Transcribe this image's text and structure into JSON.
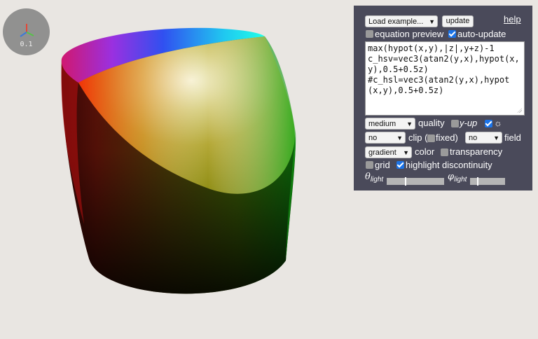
{
  "axes": {
    "scale_label": "0.1",
    "x_color": "#2f6fd8",
    "y_color": "#4bbf3a",
    "z_color": "#e23a2a"
  },
  "toolbar": {
    "example_select": "Load example...",
    "update_label": "update",
    "help_label": "help"
  },
  "options": {
    "equation_preview": {
      "label": "equation preview",
      "checked": false
    },
    "auto_update": {
      "label": "auto-update",
      "checked": true
    }
  },
  "editor": {
    "text": "max(hypot(x,y),|z|,y+z)-1\nc_hsv=vec3(atan2(y,x),hypot(x,y),0.5+0.5z)\n#c_hsl=vec3(atan2(y,x),hypot(x,y),0.5+0.5z)"
  },
  "controls": {
    "quality_select": "medium",
    "quality_label": "quality",
    "y_up": {
      "label": "y-up",
      "checked": false
    },
    "light_toggle": {
      "label": "☼",
      "checked": true
    },
    "clip_select": "no",
    "clip_label": "clip (",
    "fixed": {
      "label": "fixed)",
      "checked": false
    },
    "field_select": "no",
    "field_label": "field",
    "color_select": "gradient",
    "color_label": "color",
    "transparency": {
      "label": "transparency",
      "checked": false
    },
    "grid": {
      "label": "grid",
      "checked": false
    },
    "highlight_discontinuity": {
      "label": "highlight discontinuity",
      "checked": true
    },
    "theta_light": {
      "symbol": "θ",
      "sub": "light",
      "level": 0.32
    },
    "phi_light": {
      "symbol": "φ",
      "sub": "light",
      "level": 0.2
    }
  }
}
